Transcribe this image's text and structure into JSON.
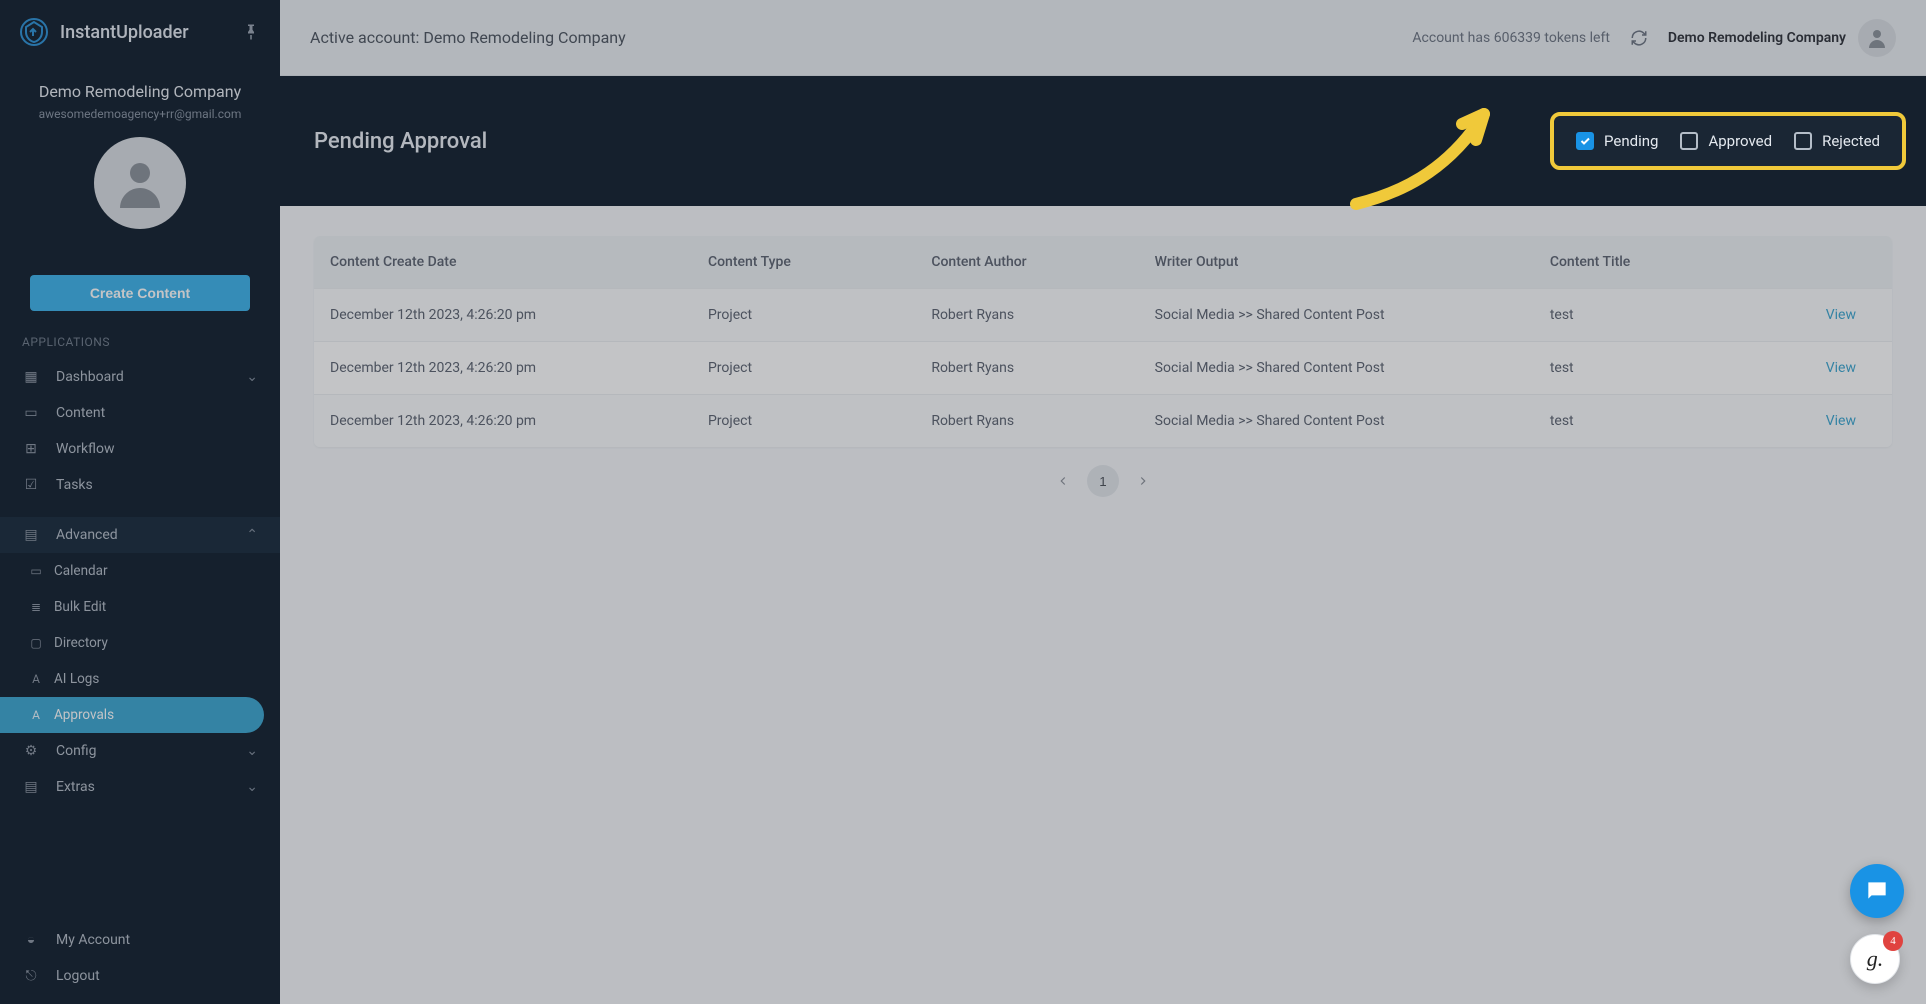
{
  "brand": {
    "name": "InstantUploader"
  },
  "account": {
    "company": "Demo Remodeling Company",
    "email": "awesomedemoagency+rr@gmail.com"
  },
  "create_button": "Create Content",
  "sections": {
    "applications": "APPLICATIONS"
  },
  "nav": {
    "dashboard": "Dashboard",
    "content": "Content",
    "workflow": "Workflow",
    "tasks": "Tasks",
    "advanced": "Advanced",
    "calendar": "Calendar",
    "bulk_edit": "Bulk Edit",
    "directory": "Directory",
    "ai_logs": "AI Logs",
    "approvals": "Approvals",
    "config": "Config",
    "extras": "Extras",
    "my_account": "My Account",
    "logout": "Logout"
  },
  "topbar": {
    "active_account": "Active account: Demo Remodeling Company",
    "tokens": "Account has 606339 tokens left",
    "company": "Demo Remodeling Company"
  },
  "hero": {
    "title": "Pending Approval"
  },
  "filters": {
    "pending": "Pending",
    "approved": "Approved",
    "rejected": "Rejected"
  },
  "table": {
    "headers": {
      "date": "Content Create Date",
      "type": "Content Type",
      "author": "Content Author",
      "writer": "Writer Output",
      "title": "Content Title"
    },
    "rows": [
      {
        "date": "December 12th 2023, 4:26:20 pm",
        "type": "Project",
        "author": "Robert Ryans",
        "writer": "Social Media >> Shared Content Post",
        "title": "test",
        "view": "View"
      },
      {
        "date": "December 12th 2023, 4:26:20 pm",
        "type": "Project",
        "author": "Robert Ryans",
        "writer": "Social Media >> Shared Content Post",
        "title": "test",
        "view": "View"
      },
      {
        "date": "December 12th 2023, 4:26:20 pm",
        "type": "Project",
        "author": "Robert Ryans",
        "writer": "Social Media >> Shared Content Post",
        "title": "test",
        "view": "View"
      }
    ]
  },
  "pager": {
    "page": "1"
  },
  "g_fab": {
    "label": "g.",
    "badge": "4"
  }
}
